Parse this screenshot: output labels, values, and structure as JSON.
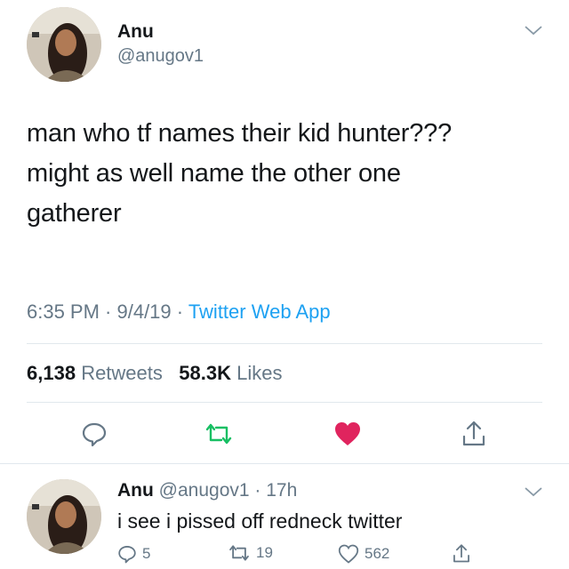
{
  "tweet": {
    "author_name": "Anu",
    "author_handle": "@anugov1",
    "text_line1": "man who tf names their kid hunter???",
    "text_line2": "might as well name the other one",
    "text_line3": "gatherer",
    "timestamp": "6:35 PM · 9/4/19 · ",
    "source": "Twitter Web App",
    "retweets_count": "6,138",
    "retweets_label": "Retweets",
    "likes_count": "58.3K",
    "likes_label": "Likes"
  },
  "reply": {
    "author_name": "Anu",
    "author_handle": "@anugov1 · 17h",
    "text": "i see i pissed off redneck twitter",
    "replies": "5",
    "retweets": "19",
    "likes": "562"
  },
  "icons": [
    "chevron-down-icon",
    "reply-icon",
    "retweet-icon",
    "heart-icon",
    "share-icon"
  ],
  "colors": {
    "accent": "#1da1f2",
    "retweet": "#17bf63",
    "like": "#e0245e",
    "muted": "#657786"
  }
}
